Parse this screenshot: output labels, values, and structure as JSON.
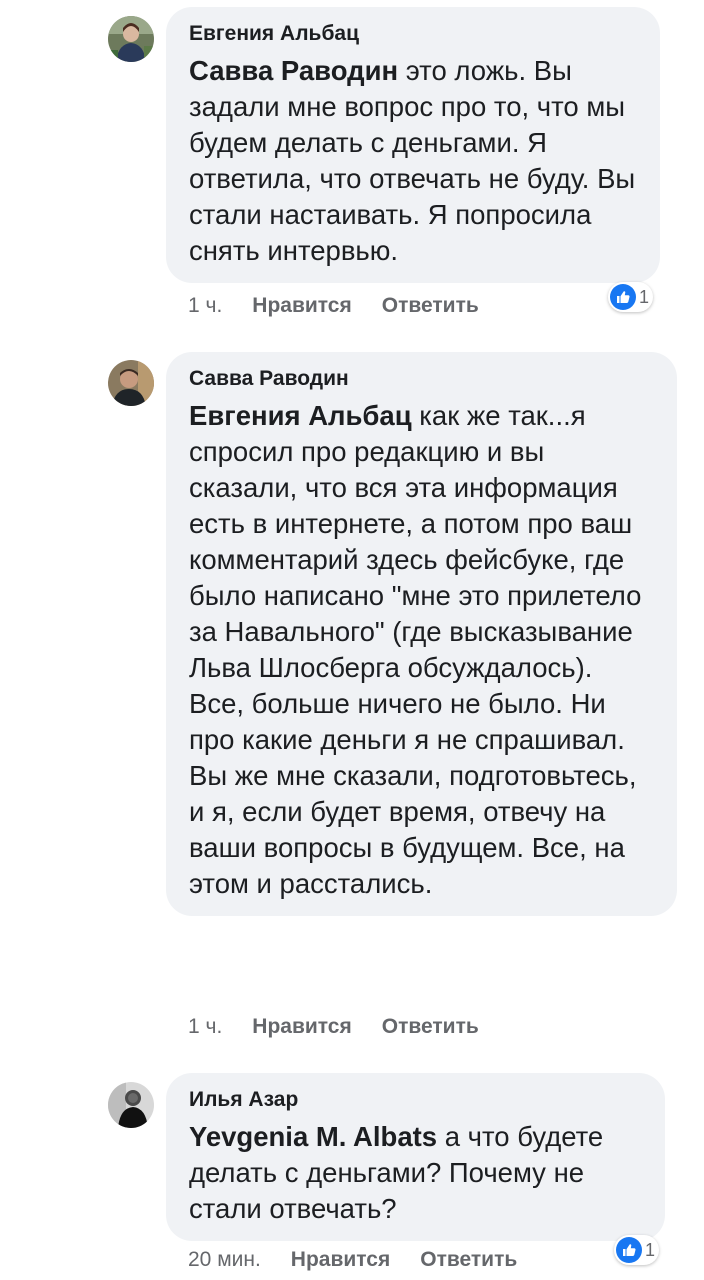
{
  "comments": [
    {
      "author": "Евгения Альбац",
      "mention": "Савва Раводин",
      "text": " это ложь. Вы задали мне вопрос про то, что мы будем делать с деньгами. Я ответила, что отвечать не буду. Вы стали настаивать. Я попросила снять интервью.",
      "time": "1 ч.",
      "like_label": "Нравится",
      "reply_label": "Ответить",
      "reaction_count": "1"
    },
    {
      "author": "Савва Раводин",
      "mention": "Евгения Альбац",
      "text": " как же так...я спросил про редакцию и вы сказали, что вся эта информация есть в интернете, а потом про ваш комментарий здесь фейсбуке, где было написано \"мне это прилетело за Навального\" (где высказывание Льва Шлосберга обсуждалось). Все, больше ничего не было. Ни про какие деньги я не спрашивал. Вы же мне сказали, подготовьтесь, и я, если будет время, отвечу на ваши вопросы в будущем. Все, на этом и расстались.",
      "time": "1 ч.",
      "like_label": "Нравится",
      "reply_label": "Ответить"
    },
    {
      "author": "Илья Азар",
      "mention": "Yevgenia M. Albats",
      "text": " а что будете делать с деньгами? Почему не стали отвечать?",
      "time": "20 мин.",
      "like_label": "Нравится",
      "reply_label": "Ответить",
      "reaction_count": "1"
    }
  ],
  "icons": {
    "like": "thumbs-up-icon"
  },
  "colors": {
    "bubble": "#f0f2f5",
    "meta_text": "#65676b",
    "like_blue": "#1877f2"
  }
}
